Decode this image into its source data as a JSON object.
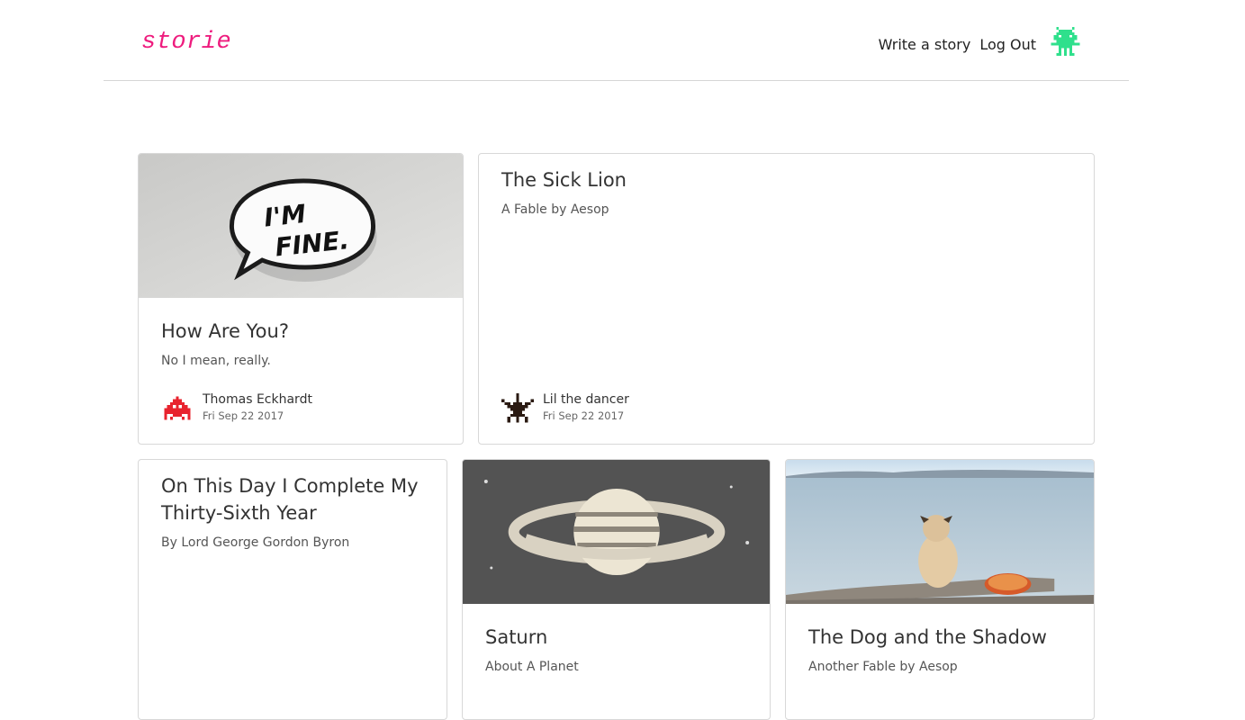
{
  "app": {
    "logo": "storie"
  },
  "nav": {
    "write": "Write a story",
    "logout": "Log Out"
  },
  "stories": [
    {
      "title": "How Are You?",
      "subtitle": "No I mean, really.",
      "author": "Thomas Eckhardt",
      "date": "Fri Sep 22 2017"
    },
    {
      "title": "The Sick Lion",
      "subtitle": "A Fable by Aesop",
      "author": "Lil the dancer",
      "date": "Fri Sep 22 2017"
    },
    {
      "title": "On This Day I Complete My Thirty-Sixth Year",
      "subtitle": "By Lord George Gordon Byron"
    },
    {
      "title": "Saturn",
      "subtitle": "About A Planet"
    },
    {
      "title": "The Dog and the Shadow",
      "subtitle": "Another Fable by Aesop"
    }
  ],
  "images": {
    "im_fine_pin": "I'M FINE."
  },
  "colors": {
    "brand": "#ee1c7e",
    "avatar_top": "#2fe08c",
    "avatar_red": "#e8232e",
    "avatar_dark": "#2a1a12"
  }
}
